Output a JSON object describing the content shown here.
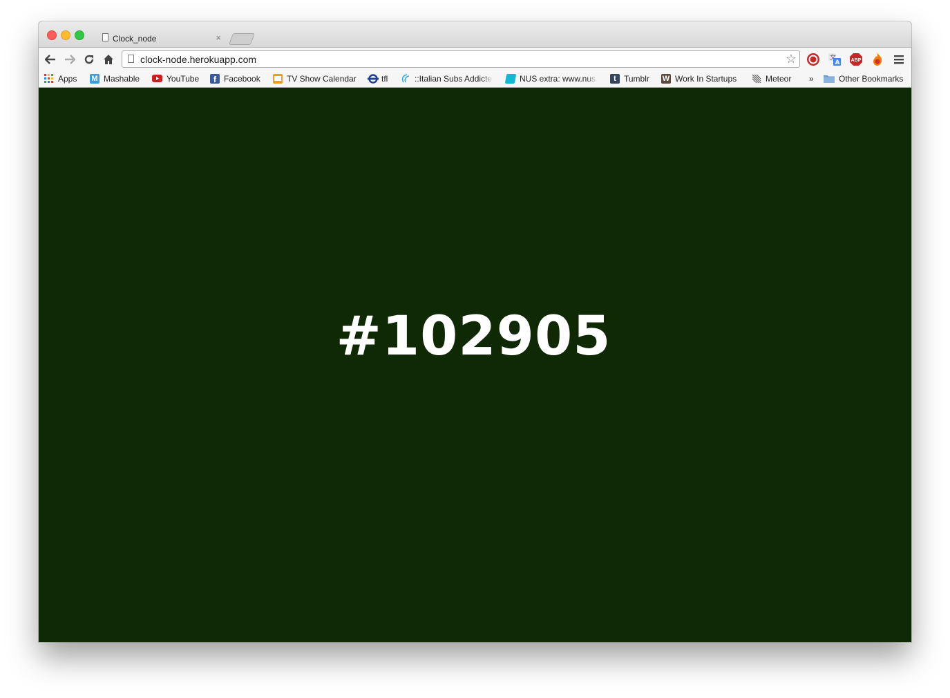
{
  "tab": {
    "title": "Clock_node",
    "close": "×"
  },
  "omnibox": {
    "url": "clock-node.herokuapp.com"
  },
  "bookmarks": {
    "items": [
      {
        "label": "Apps",
        "icon": "apps-grid-icon"
      },
      {
        "label": "Mashable",
        "icon": "mashable-icon"
      },
      {
        "label": "YouTube",
        "icon": "youtube-icon"
      },
      {
        "label": "Facebook",
        "icon": "facebook-icon"
      },
      {
        "label": "TV Show Calendar",
        "icon": "tv-icon"
      },
      {
        "label": "tfl",
        "icon": "tfl-roundel-icon"
      },
      {
        "label": "::Italian Subs Addicte",
        "icon": "subs-icon"
      },
      {
        "label": "NUS extra: www.nus",
        "icon": "nus-icon"
      },
      {
        "label": "Tumblr",
        "icon": "tumblr-icon"
      },
      {
        "label": "Work In Startups",
        "icon": "wis-icon"
      },
      {
        "label": "Meteor",
        "icon": "meteor-icon"
      }
    ],
    "overflow": "»",
    "other": "Other Bookmarks"
  },
  "extensions": {
    "abp": "ABP"
  },
  "page": {
    "hex_value": "#102905"
  },
  "colors": {
    "background": "#102905",
    "text": "#ffffff"
  }
}
